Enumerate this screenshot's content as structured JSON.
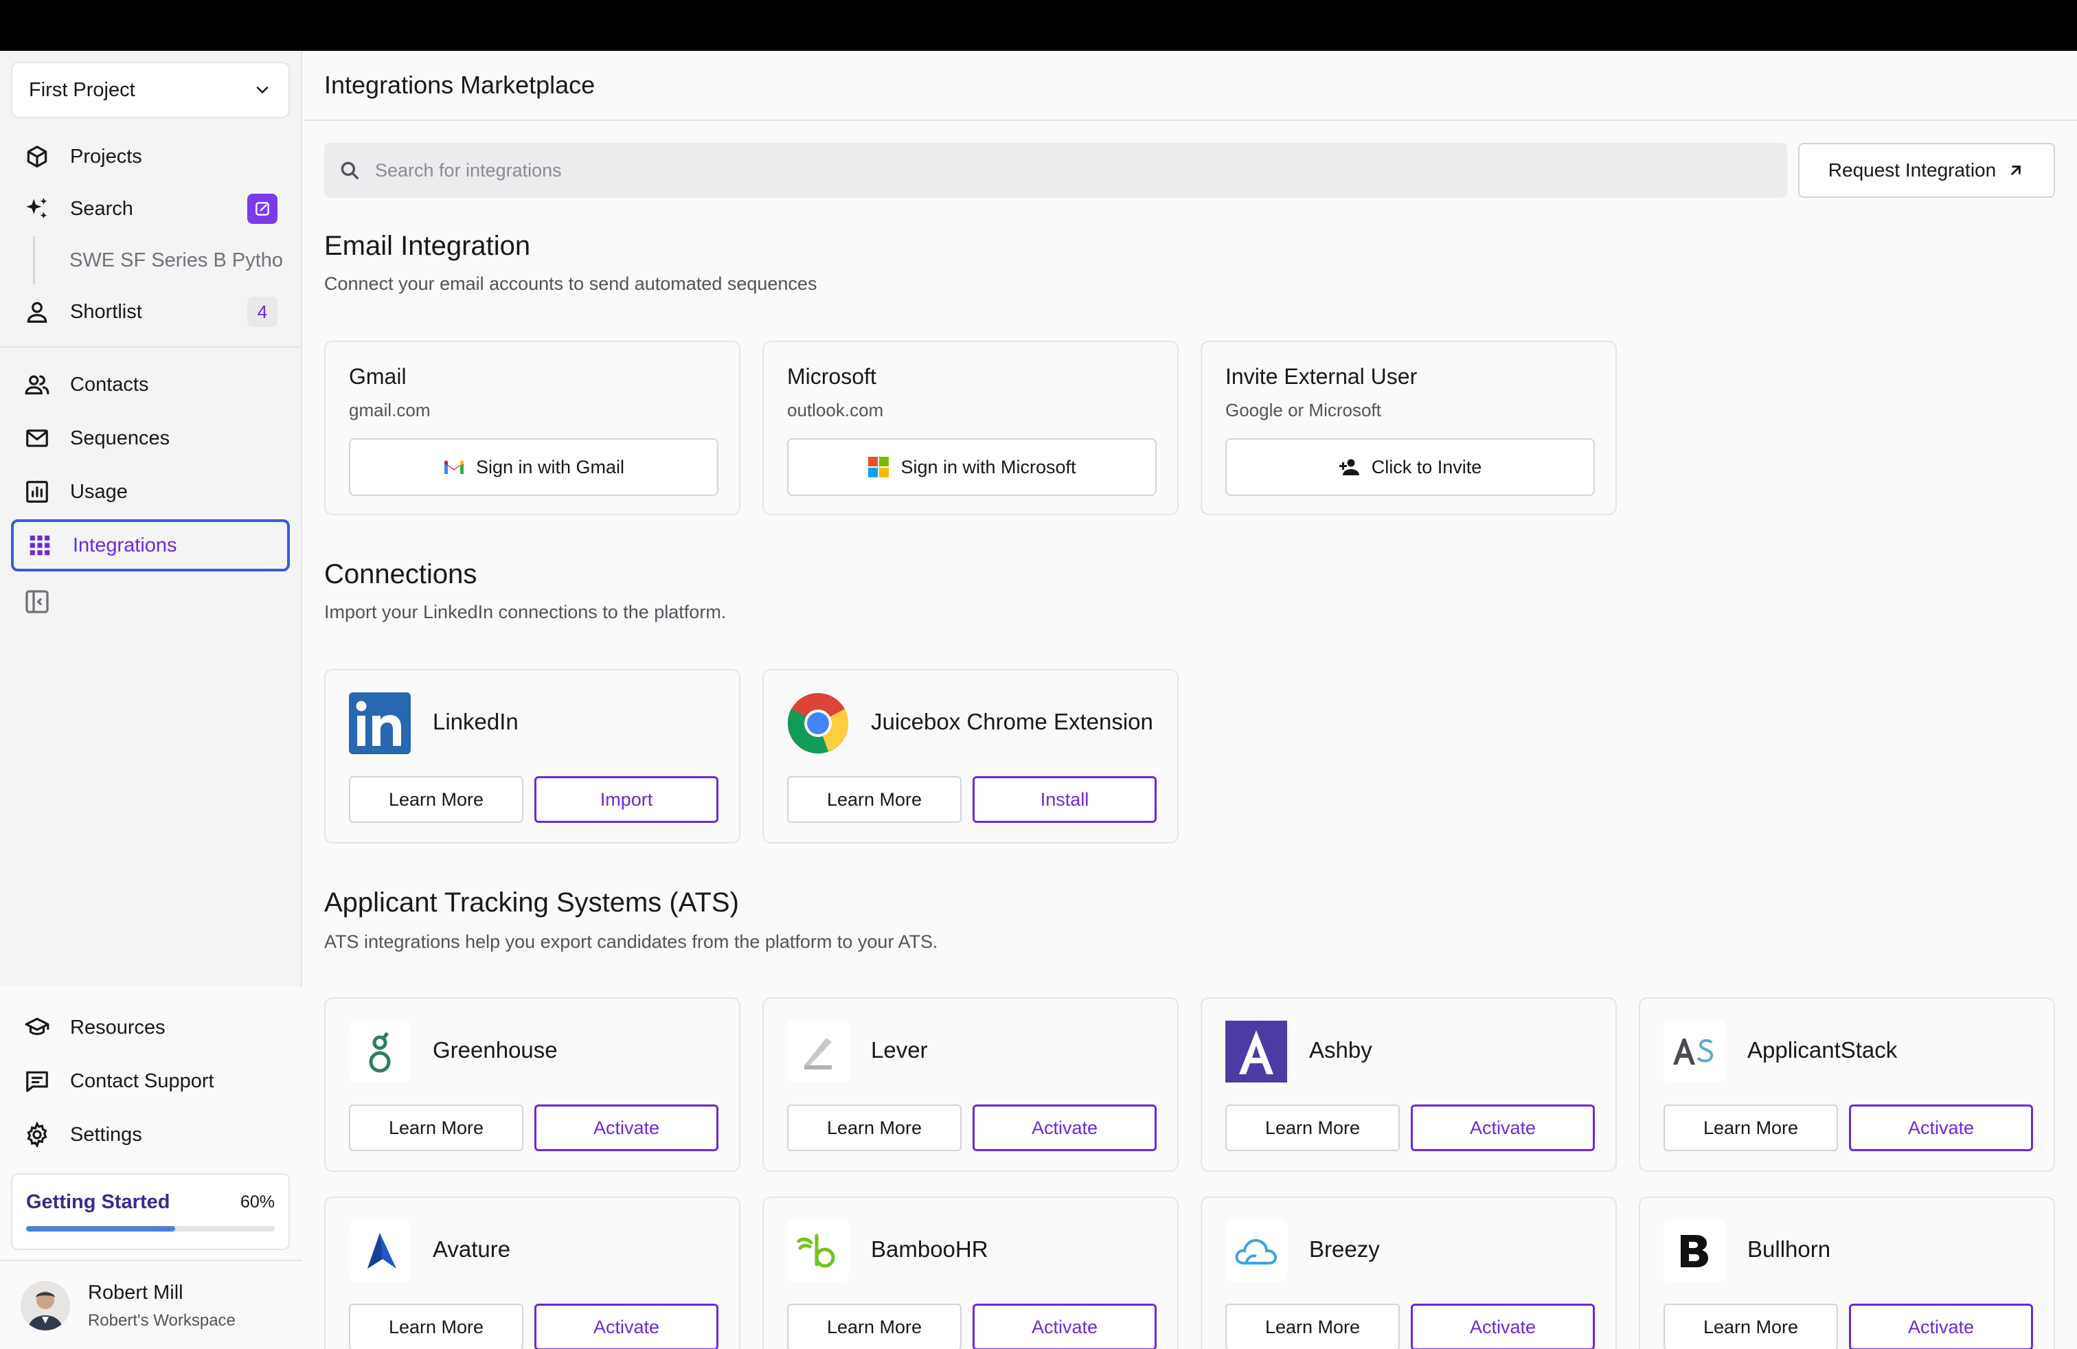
{
  "sidebar": {
    "project": "First Project",
    "nav": {
      "projects": "Projects",
      "search": "Search",
      "search_sub": "SWE SF Series B Pytho",
      "shortlist": "Shortlist",
      "shortlist_count": "4",
      "contacts": "Contacts",
      "sequences": "Sequences",
      "usage": "Usage",
      "integrations": "Integrations"
    },
    "bottom": {
      "resources": "Resources",
      "support": "Contact Support",
      "settings": "Settings"
    },
    "getting_started": {
      "label": "Getting Started",
      "percent": "60%",
      "progress": 0.6
    },
    "user": {
      "name": "Robert Mill",
      "workspace": "Robert's Workspace"
    }
  },
  "main": {
    "title": "Integrations Marketplace",
    "search_placeholder": "Search for integrations",
    "request_button": "Request Integration",
    "email": {
      "title": "Email Integration",
      "subtitle": "Connect your email accounts to send automated sequences",
      "cards": [
        {
          "title": "Gmail",
          "sub": "gmail.com",
          "button": "Sign in with Gmail",
          "icon": "gmail-icon"
        },
        {
          "title": "Microsoft",
          "sub": "outlook.com",
          "button": "Sign in with Microsoft",
          "icon": "microsoft-icon"
        },
        {
          "title": "Invite External User",
          "sub": "Google or Microsoft",
          "button": "Click to Invite",
          "icon": "add-user-icon"
        }
      ]
    },
    "connections": {
      "title": "Connections",
      "subtitle": "Import your LinkedIn connections to the platform.",
      "cards": [
        {
          "name": "LinkedIn",
          "learn": "Learn More",
          "action": "Import",
          "icon": "linkedin-icon"
        },
        {
          "name": "Juicebox Chrome Extension",
          "learn": "Learn More",
          "action": "Install",
          "icon": "chrome-icon"
        }
      ]
    },
    "ats": {
      "title": "Applicant Tracking Systems (ATS)",
      "subtitle": "ATS integrations help you export candidates from the platform to your ATS.",
      "cards": [
        {
          "name": "Greenhouse",
          "learn": "Learn More",
          "action": "Activate",
          "icon": "greenhouse-icon"
        },
        {
          "name": "Lever",
          "learn": "Learn More",
          "action": "Activate",
          "icon": "lever-icon"
        },
        {
          "name": "Ashby",
          "learn": "Learn More",
          "action": "Activate",
          "icon": "ashby-icon"
        },
        {
          "name": "ApplicantStack",
          "learn": "Learn More",
          "action": "Activate",
          "icon": "applicantstack-icon"
        },
        {
          "name": "Avature",
          "learn": "Learn More",
          "action": "Activate",
          "icon": "avature-icon"
        },
        {
          "name": "BambooHR",
          "learn": "Learn More",
          "action": "Activate",
          "icon": "bamboohr-icon"
        },
        {
          "name": "Breezy",
          "learn": "Learn More",
          "action": "Activate",
          "icon": "breezy-icon"
        },
        {
          "name": "Bullhorn",
          "learn": "Learn More",
          "action": "Activate",
          "icon": "bullhorn-icon"
        }
      ]
    }
  },
  "colors": {
    "accent": "#6d28d9",
    "active_border": "#3b5bdb",
    "progress": "#4f7fd8"
  }
}
